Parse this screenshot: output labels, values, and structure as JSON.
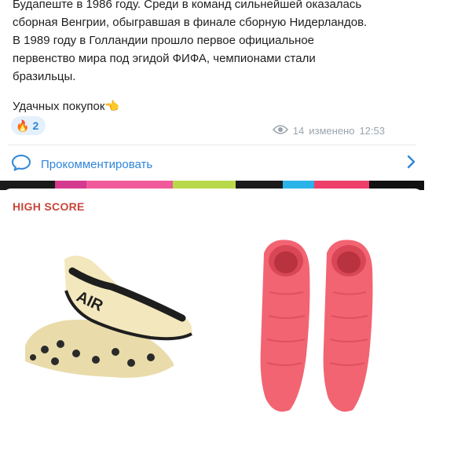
{
  "message": {
    "text": "Будапеште в 1986 году. Среди в команд сильнейшей оказалась\nсборная Венгрии, обыгравшая в финале сборную Нидерландов.\nВ 1989 году в Голландии прошло первое официальное\nпервенство мира под эгидой ФИФА, чемпионами стали\nбразильцы.",
    "wish": "Удачных покупок",
    "wish_emoji": "👈",
    "reaction_emoji": "🔥",
    "reaction_count": "2",
    "views": "14",
    "edited_label": "изменено",
    "time": "12:53",
    "comment_label": "Прокомментировать"
  },
  "card": {
    "label": "HIGH SCORE",
    "products": [
      {
        "name": "cream-black-football-boots",
        "color": "#efe2b0"
      },
      {
        "name": "pink-football-boots",
        "color": "#f26472"
      }
    ]
  },
  "colors": {
    "accent": "#2f86d9",
    "label": "#c8463a",
    "meta": "#9aa4ad"
  }
}
